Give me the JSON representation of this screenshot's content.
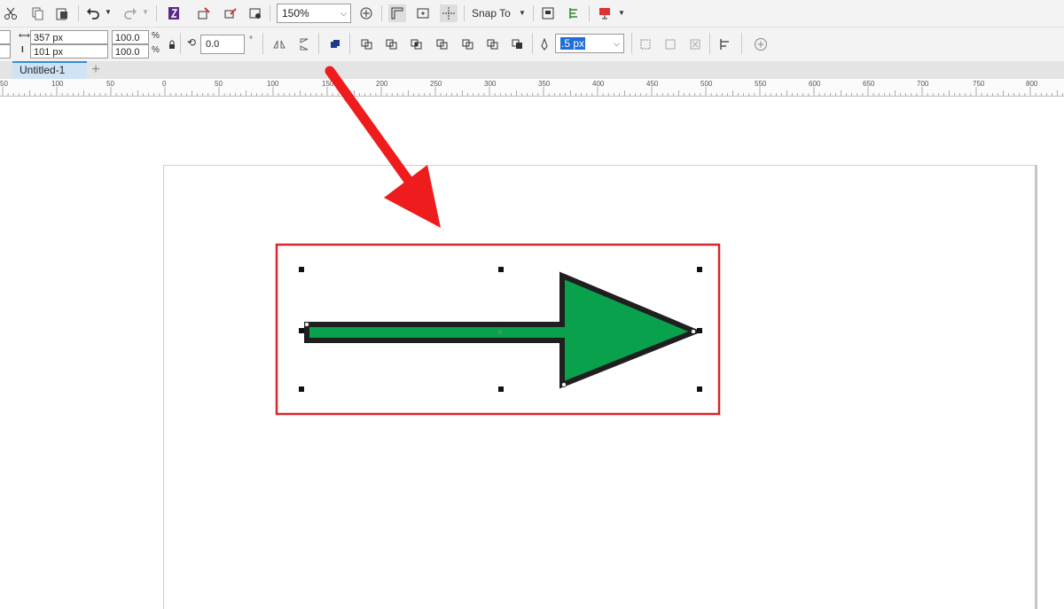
{
  "toolbar_top": {
    "zoom": "150%",
    "snap_to": "Snap To"
  },
  "toolbar_property": {
    "width": "357 px",
    "height": "101 px",
    "scale_x": "100.0",
    "scale_y": "100.0",
    "percent_symbol": "%",
    "rotation": "0.0",
    "degree_symbol": "°",
    "outline_width": ".5 px"
  },
  "tabs": [
    {
      "label": "Untitled-1"
    }
  ],
  "tab_add_symbol": "+",
  "ruler_labels": [
    "50",
    "100",
    "50",
    "0",
    "50",
    "100",
    "150",
    "200",
    "250",
    "300",
    "350",
    "400",
    "450",
    "500",
    "550",
    "600",
    "650",
    "700",
    "750",
    "800"
  ],
  "colors": {
    "arrow_fill": "#0aa14c",
    "arrow_outline": "#1f1f1f",
    "highlight_box": "#d9262b",
    "pointer_arrow": "#ee1c1c",
    "tab_active": "#cfe3f5"
  },
  "icons": {
    "cut": "scissors-icon",
    "copy": "copy-icon",
    "paste": "paste-icon",
    "undo": "undo-icon",
    "redo": "redo-icon"
  }
}
